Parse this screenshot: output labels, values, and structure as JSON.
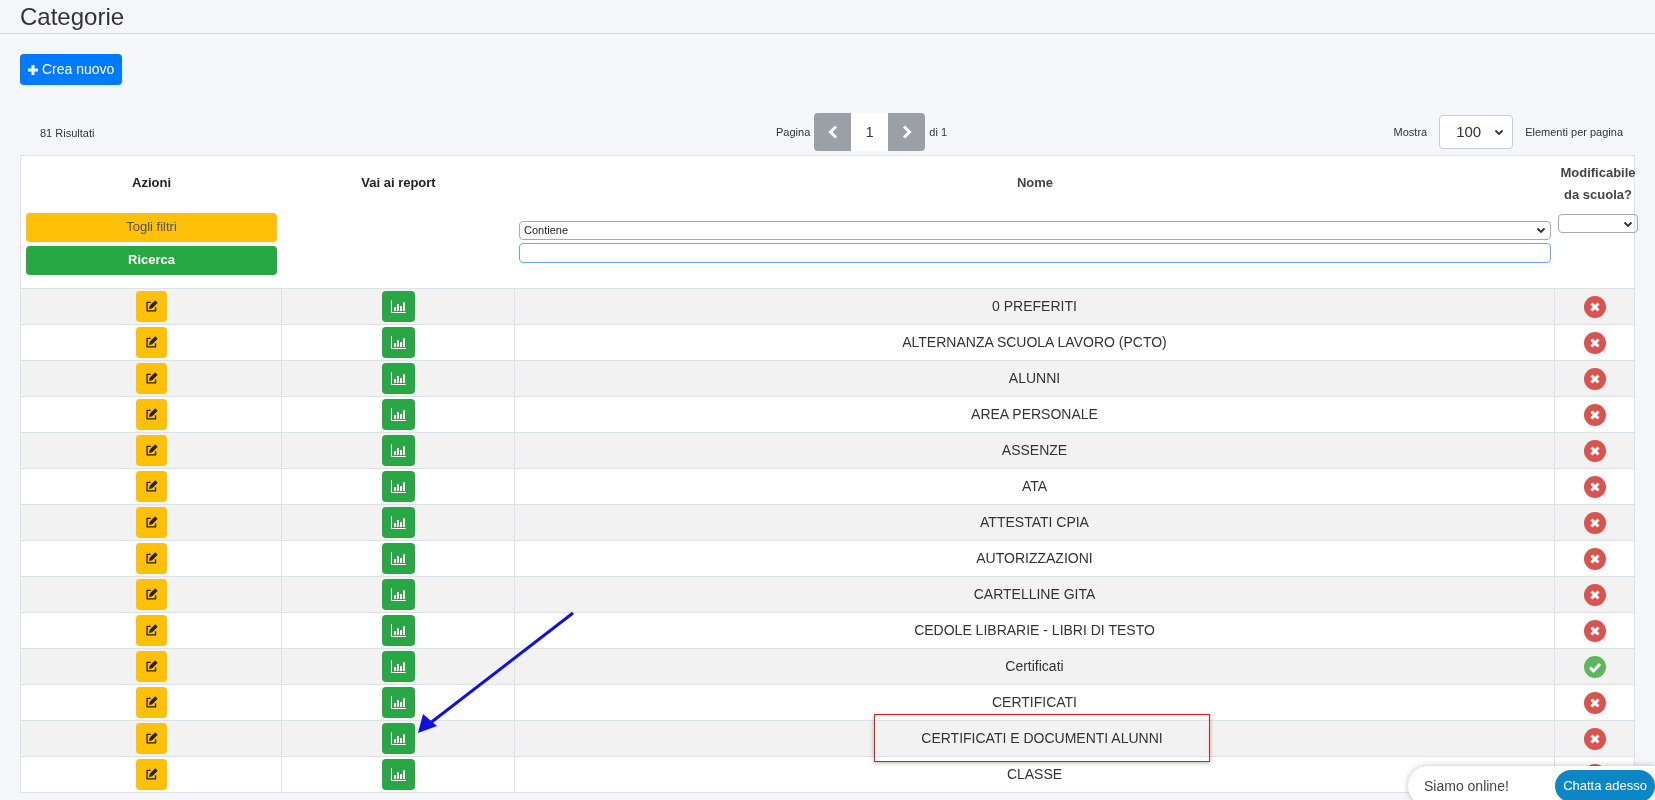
{
  "page_title": "Categorie",
  "create_button": "Crea nuovo",
  "results": "81 Risultati",
  "pagination": {
    "label": "Pagina",
    "page": "1",
    "of": "di 1"
  },
  "page_size": {
    "label": "Mostra",
    "value": "100",
    "suffix": "Elementi per pagina"
  },
  "table": {
    "columns": [
      "Azioni",
      "Vai ai report",
      "Nome",
      "Modificabile da scuola?"
    ],
    "filters": {
      "clear": "Togli filtri",
      "search": "Ricerca",
      "match": "Contiene"
    },
    "rows": [
      {
        "name": "0 PREFERITI",
        "editable": false,
        "highlighted": false
      },
      {
        "name": "ALTERNANZA SCUOLA LAVORO (PCTO)",
        "editable": false,
        "highlighted": false
      },
      {
        "name": "ALUNNI",
        "editable": false,
        "highlighted": false
      },
      {
        "name": "AREA PERSONALE",
        "editable": false,
        "highlighted": false
      },
      {
        "name": "ASSENZE",
        "editable": false,
        "highlighted": false
      },
      {
        "name": "ATA",
        "editable": false,
        "highlighted": false
      },
      {
        "name": "ATTESTATI CPIA",
        "editable": false,
        "highlighted": false
      },
      {
        "name": "AUTORIZZAZIONI",
        "editable": false,
        "highlighted": false
      },
      {
        "name": "CARTELLINE GITA",
        "editable": false,
        "highlighted": false
      },
      {
        "name": "CEDOLE LIBRARIE - LIBRI DI TESTO",
        "editable": false,
        "highlighted": false
      },
      {
        "name": "Certificati",
        "editable": true,
        "highlighted": false
      },
      {
        "name": "CERTIFICATI",
        "editable": false,
        "highlighted": false
      },
      {
        "name": "CERTIFICATI E DOCUMENTI ALUNNI",
        "editable": false,
        "highlighted": true
      },
      {
        "name": "CLASSE",
        "editable": false,
        "highlighted": false
      }
    ]
  },
  "chat": {
    "status": "Siamo online!",
    "button": "Chatta adesso"
  }
}
